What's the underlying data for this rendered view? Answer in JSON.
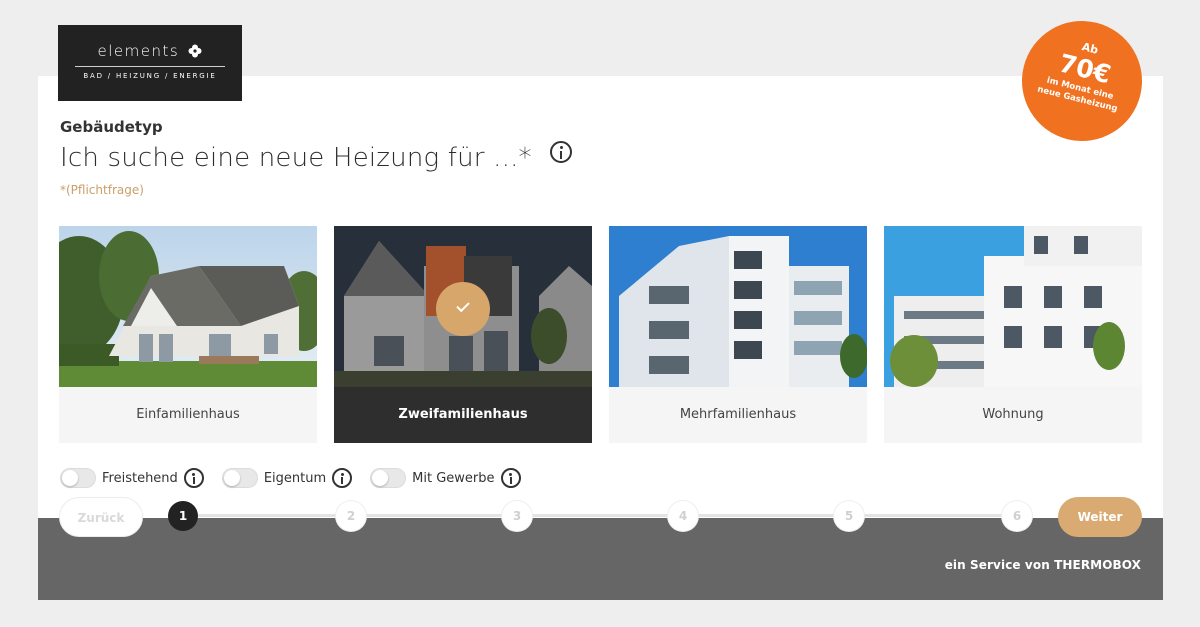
{
  "brand": {
    "name": "elements",
    "tagline": "BAD / HEIZUNG / ENERGIE"
  },
  "promo": {
    "prefix": "Ab",
    "price": "70€",
    "text": "im Monat eine neue Gasheizung"
  },
  "question": {
    "label": "Gebäudetyp",
    "title": "Ich suche eine neue Heizung für ...*",
    "required_note": "*(Pflichtfrage)"
  },
  "options": [
    {
      "label": "Einfamilienhaus",
      "selected": false
    },
    {
      "label": "Zweifamilienhaus",
      "selected": true
    },
    {
      "label": "Mehrfamilienhaus",
      "selected": false
    },
    {
      "label": "Wohnung",
      "selected": false
    }
  ],
  "toggles": [
    {
      "label": "Freistehend",
      "on": false
    },
    {
      "label": "Eigentum",
      "on": false
    },
    {
      "label": "Mit Gewerbe",
      "on": false
    }
  ],
  "navigation": {
    "back_label": "Zurück",
    "next_label": "Weiter",
    "steps": [
      "1",
      "2",
      "3",
      "4",
      "5",
      "6"
    ],
    "current_step": 1
  },
  "footer": {
    "service_text": "ein Service von THERMOBOX"
  },
  "colors": {
    "accent": "#d9aa72",
    "promo": "#f07221",
    "selected_bg": "#2e2e2e",
    "footer_bg": "#666666"
  }
}
